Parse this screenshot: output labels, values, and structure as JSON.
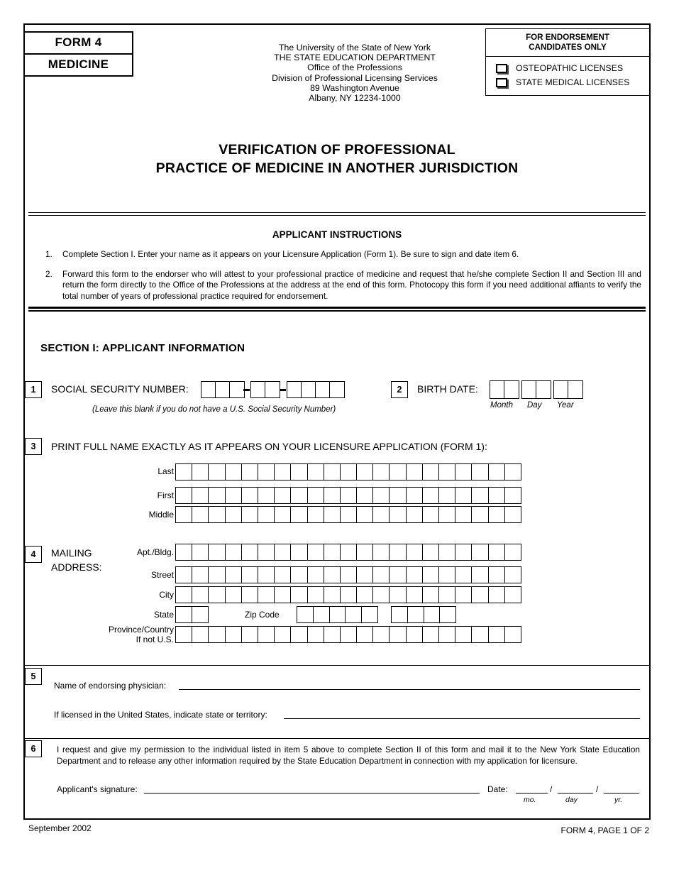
{
  "header": {
    "form_tag_line1": "FORM 4",
    "form_tag_line2": "MEDICINE",
    "agency": {
      "line1": "The University of the State of New York",
      "line2": "THE STATE EDUCATION DEPARTMENT",
      "line3": "Office of the Professions",
      "line4": "Division of Professional Licensing Services",
      "line5": "89 Washington Avenue",
      "line6": "Albany, NY 12234-1000"
    },
    "endorsement": {
      "title_line1": "FOR ENDORSEMENT",
      "title_line2": "CANDIDATES ONLY",
      "option1": "OSTEOPATHIC LICENSES",
      "option2": "STATE MEDICAL LICENSES"
    }
  },
  "title": {
    "line1": "VERIFICATION OF PROFESSIONAL",
    "line2": "PRACTICE OF MEDICINE IN ANOTHER JURISDICTION"
  },
  "instructions": {
    "heading": "APPLICANT INSTRUCTIONS",
    "items": [
      {
        "num": "1.",
        "text": "Complete Section I.   Enter your name as it appears on your Licensure Application (Form 1). Be sure to sign and date item 6."
      },
      {
        "num": "2.",
        "text": "Forward this form to the endorser who will attest to your professional practice of medicine and request that he/she complete Section II and Section III and return the form directly to the Office of the Professions at the address at the end of this form.   Photocopy this form if you need additional affiants to verify the total number of years of professional practice required for endorsement."
      }
    ]
  },
  "section1": {
    "heading": "SECTION I:  APPLICANT INFORMATION",
    "item1": {
      "num": "1",
      "label": "SOCIAL SECURITY NUMBER:",
      "note": "(Leave this blank if you do not have a U.S. Social Security Number)",
      "groups": [
        3,
        2,
        4
      ]
    },
    "item2": {
      "num": "2",
      "label": "BIRTH DATE:",
      "sub_labels": [
        "Month",
        "Day",
        "Year"
      ],
      "groups": [
        2,
        2,
        2
      ]
    },
    "item3": {
      "num": "3",
      "label": "PRINT FULL NAME EXACTLY AS IT APPEARS  ON YOUR LICENSURE APPLICATION (FORM 1):",
      "rows": [
        {
          "label": "Last",
          "cells": 21
        },
        {
          "label": "First",
          "cells": 21
        },
        {
          "label": "Middle",
          "cells": 21
        }
      ]
    },
    "item4": {
      "num": "4",
      "label_line1": "MAILING",
      "label_line2": "ADDRESS:",
      "rows": [
        {
          "label": "Apt./Bldg.",
          "cells": 21
        },
        {
          "label": "Street",
          "cells": 21
        },
        {
          "label": "City",
          "cells": 21
        }
      ],
      "state": {
        "label": "State",
        "cells": 2
      },
      "zip": {
        "label": "Zip Code",
        "cells_main": 5,
        "cells_plus4": 4
      },
      "province": {
        "label_line1": "Province/Country",
        "label_line2": "If not U.S.",
        "cells": 21
      }
    },
    "item5": {
      "num": "5",
      "field1_label": "Name of endorsing physician:",
      "field2_label": "If licensed in the United States, indicate state or territory:"
    },
    "item6": {
      "num": "6",
      "text": "I request and give my permission to the individual listed in item 5 above to complete Section II of this form and mail it to the New York State Education Department and to release any other information required by the State Education Department in connection with my application for licensure.",
      "signature_label": "Applicant's signature:",
      "date_label": "Date:",
      "date_sub": [
        "mo.",
        "day",
        "yr."
      ],
      "date_sep": "/"
    }
  },
  "footer": {
    "left": "September 2002",
    "right": "FORM 4, PAGE 1 OF 2"
  }
}
